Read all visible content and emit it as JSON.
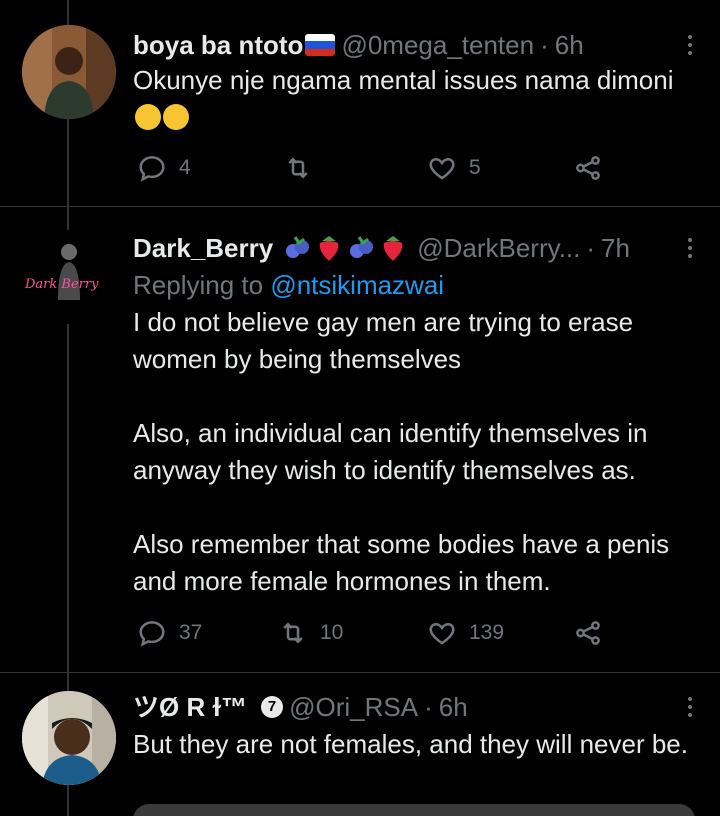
{
  "tweets": [
    {
      "name": "boya ba ntoto",
      "handle": "@0mega_tenten",
      "time": "6h",
      "text": "Okunye nje ngama mental issues nama dimoni",
      "actions": {
        "reply": "4",
        "retweet": "",
        "like": "5"
      }
    },
    {
      "name": "Dark_Berry",
      "handle": "@DarkBerry...",
      "time": "7h",
      "replying_prefix": "Replying to ",
      "replying_to": "@ntsikimazwai",
      "avatar_text": "Dark Berry",
      "text": "I do not believe gay men are trying to erase women by being themselves\n\nAlso, an individual can identify themselves in anyway they wish to identify themselves as.\n\nAlso remember that some bodies have a penis and more female hormones in them.",
      "actions": {
        "reply": "37",
        "retweet": "10",
        "like": "139"
      }
    },
    {
      "name": "ツØ R ɫ™",
      "badge": "7",
      "handle": "@Ori_RSA",
      "time": "6h",
      "text": "But they are not females, and they will never be."
    }
  ],
  "separator": "·",
  "colors": {
    "background": "#000000",
    "text": "#e7e9ea",
    "secondary": "#71767b",
    "accent": "#1d9bf0",
    "divider": "#2f3336"
  },
  "icons": [
    "reply-icon",
    "retweet-icon",
    "like-icon",
    "share-icon",
    "more-icon",
    "flag-icon",
    "emoji-icon",
    "blueberry-icon",
    "strawberry-icon"
  ]
}
